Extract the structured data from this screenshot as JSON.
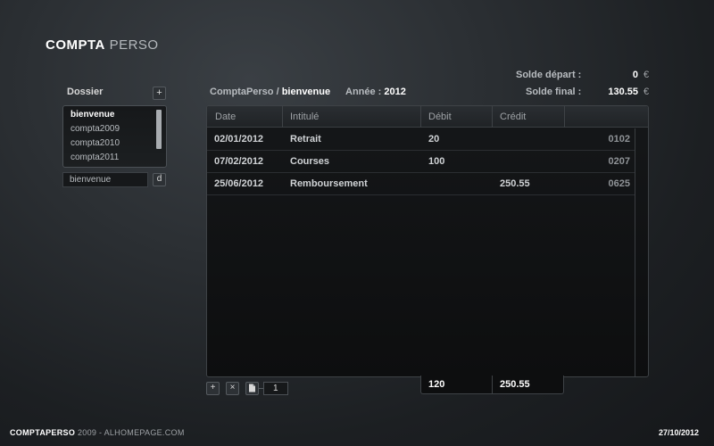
{
  "app": {
    "title_bold": "COMPTA",
    "title_light": "PERSO"
  },
  "sidebar": {
    "label": "Dossier",
    "add_label": "+",
    "items": [
      {
        "label": "bienvenue",
        "selected": true
      },
      {
        "label": "compta2009"
      },
      {
        "label": "compta2010"
      },
      {
        "label": "compta2011"
      }
    ],
    "rename_value": "bienvenue",
    "delete_label": "d"
  },
  "header": {
    "breadcrumb_root": "ComptaPerso /",
    "breadcrumb_current": "bienvenue",
    "year_label": "Année :",
    "year_value": "2012"
  },
  "balances": {
    "start_label": "Solde départ :",
    "start_value": "0",
    "final_label": "Solde final :",
    "final_value": "130.55",
    "currency": "€"
  },
  "table": {
    "columns": [
      "Date",
      "Intitulé",
      "Débit",
      "Crédit"
    ],
    "rows": [
      {
        "date": "02/01/2012",
        "label": "Retrait",
        "debit": "20",
        "credit": "",
        "num": "0102"
      },
      {
        "date": "07/02/2012",
        "label": "Courses",
        "debit": "100",
        "credit": "",
        "num": "0207"
      },
      {
        "date": "25/06/2012",
        "label": "Remboursement",
        "debit": "",
        "credit": "250.55",
        "num": "0625"
      }
    ],
    "total_debit": "120",
    "total_credit": "250.55"
  },
  "toolbar": {
    "add_label": "+",
    "delete_label": "×",
    "page_icon": "page-icon",
    "page_value": "1"
  },
  "footer": {
    "brand": "COMPTAPERSO",
    "suffix": "2009 - ALHOMEPAGE.COM",
    "date": "27/10/2012"
  }
}
